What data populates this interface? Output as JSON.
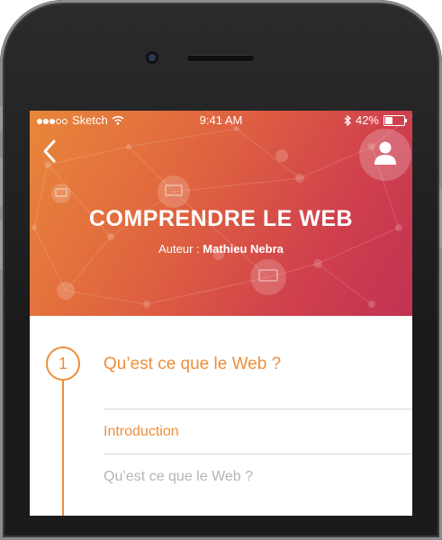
{
  "status_bar": {
    "carrier": "Sketch",
    "time": "9:41 AM",
    "battery_percent": "42%",
    "battery_level": 0.42,
    "signal_bars": 5,
    "signal_filled": 3,
    "icons": [
      "signal-dots-icon",
      "wifi-icon",
      "bluetooth-icon",
      "battery-icon"
    ]
  },
  "header": {
    "back_icon": "chevron-left-icon",
    "profile_icon": "user-icon",
    "course_title": "COMPRENDRE LE WEB",
    "author_label": "Auteur :",
    "author_name": "Mathieu Nebra"
  },
  "chapter": {
    "number": "1",
    "title": "Qu’est ce que le Web ?",
    "lessons": [
      {
        "label": "Introduction",
        "state": "active"
      },
      {
        "label": "Qu’est ce que le Web ?",
        "state": "inactive"
      }
    ]
  },
  "colors": {
    "accent": "#ee8e3b",
    "hero_start": "#e8873a",
    "hero_end": "#c13352",
    "divider": "#d9d9d9",
    "muted_text": "#b5b5b5"
  }
}
